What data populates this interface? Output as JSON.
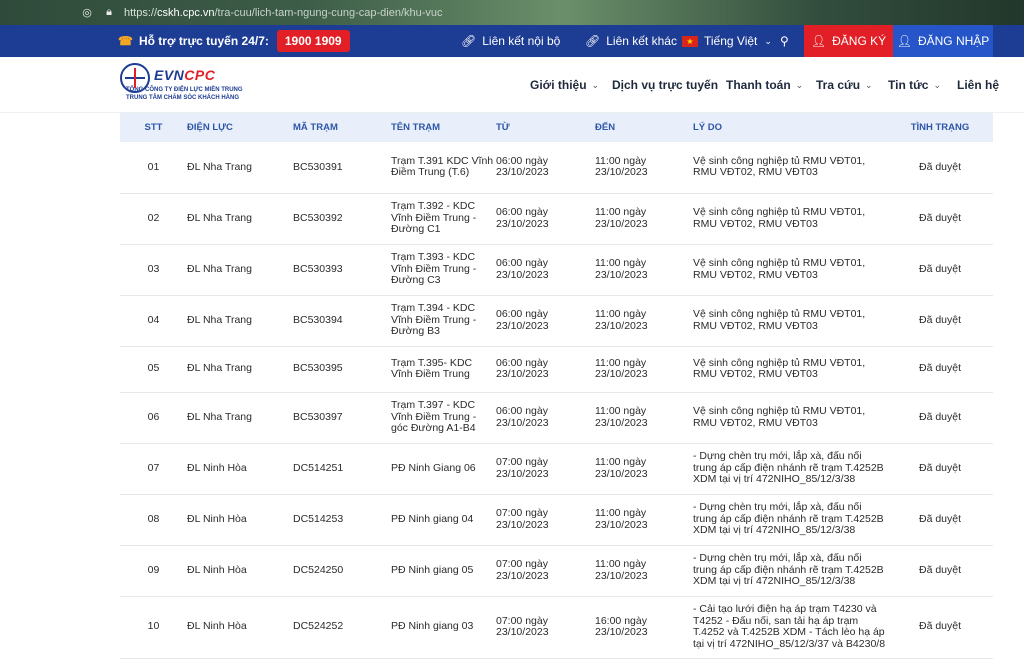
{
  "browser": {
    "url_prefix": "https://",
    "url_host": "cskh.cpc.vn",
    "url_path": "/tra-cuu/lich-tam-ngung-cung-cap-dien/khu-vuc"
  },
  "topbar": {
    "support_label": "Hỗ trợ trực tuyến 24/7:",
    "hotline": "1900 1909",
    "internal_link": "Liên kết nội bộ",
    "external_link": "Liên kết khác",
    "language": "Tiếng Việt",
    "register": "ĐĂNG KÝ",
    "login": "ĐĂNG NHẬP"
  },
  "logo": {
    "brand_evn": "EVN",
    "brand_cpc": "CPC",
    "line1": "TỔNG CÔNG TY ĐIỆN LỰC MIỀN TRUNG",
    "line2": "TRUNG TÂM CHĂM SÓC KHÁCH HÀNG"
  },
  "nav": {
    "about": "Giới thiệu",
    "services": "Dịch vụ trực tuyến",
    "payment": "Thanh toán",
    "lookup": "Tra cứu",
    "news": "Tin tức",
    "contact": "Liên hệ"
  },
  "table": {
    "headers": {
      "stt": "STT",
      "district": "ĐIỆN LỰC",
      "code": "MÃ TRẠM",
      "station": "TÊN TRẠM",
      "from": "TỪ",
      "to": "ĐẾN",
      "reason": "LÝ DO",
      "status": "TÌNH TRẠNG"
    },
    "rows": [
      {
        "stt": "01",
        "district": "ĐL Nha Trang",
        "code": "BC530391",
        "station": "Trạm T.391 KDC Vĩnh Điềm Trung (T.6)",
        "from": "06:00 ngày 23/10/2023",
        "to": "11:00 ngày 23/10/2023",
        "reason": "Vệ sinh công nghiệp tủ RMU VĐT01, RMU VĐT02, RMU VĐT03",
        "status": "Đã duyệt"
      },
      {
        "stt": "02",
        "district": "ĐL Nha Trang",
        "code": "BC530392",
        "station": "Trạm T.392 - KDC Vĩnh Điềm Trung - Đường C1",
        "from": "06:00 ngày 23/10/2023",
        "to": "11:00 ngày 23/10/2023",
        "reason": "Vệ sinh công nghiệp tủ RMU VĐT01, RMU VĐT02, RMU VĐT03",
        "status": "Đã duyệt"
      },
      {
        "stt": "03",
        "district": "ĐL Nha Trang",
        "code": "BC530393",
        "station": "Trạm T.393 - KDC Vĩnh Điềm Trung - Đường C3",
        "from": "06:00 ngày 23/10/2023",
        "to": "11:00 ngày 23/10/2023",
        "reason": "Vệ sinh công nghiệp tủ RMU VĐT01, RMU VĐT02, RMU VĐT03",
        "status": "Đã duyệt"
      },
      {
        "stt": "04",
        "district": "ĐL Nha Trang",
        "code": "BC530394",
        "station": "Trạm T.394 - KDC Vĩnh Điềm Trung - Đường B3",
        "from": "06:00 ngày 23/10/2023",
        "to": "11:00 ngày 23/10/2023",
        "reason": "Vệ sinh công nghiệp tủ RMU VĐT01, RMU VĐT02, RMU VĐT03",
        "status": "Đã duyệt"
      },
      {
        "stt": "05",
        "district": "ĐL Nha Trang",
        "code": "BC530395",
        "station": "Trạm T.395- KDC Vĩnh Điềm Trung",
        "from": "06:00 ngày 23/10/2023",
        "to": "11:00 ngày 23/10/2023",
        "reason": "Vệ sinh công nghiệp tủ RMU VĐT01, RMU VĐT02, RMU VĐT03",
        "status": "Đã duyệt"
      },
      {
        "stt": "06",
        "district": "ĐL Nha Trang",
        "code": "BC530397",
        "station": "Trạm T.397 - KDC Vĩnh Điềm Trung - góc Đường A1-B4",
        "from": "06:00 ngày 23/10/2023",
        "to": "11:00 ngày 23/10/2023",
        "reason": "Vệ sinh công nghiệp tủ RMU VĐT01, RMU VĐT02, RMU VĐT03",
        "status": "Đã duyệt"
      },
      {
        "stt": "07",
        "district": "ĐL Ninh Hòa",
        "code": "DC514251",
        "station": "PĐ Ninh Giang 06",
        "from": "07:00 ngày 23/10/2023",
        "to": "11:00 ngày 23/10/2023",
        "reason": "- Dựng chèn trụ mới, lắp xà, đấu nối trung áp cấp điện nhánh rẽ trạm T.4252B XDM tại vị trí 472NIHO_85/12/3/38",
        "status": "Đã duyệt"
      },
      {
        "stt": "08",
        "district": "ĐL Ninh Hòa",
        "code": "DC514253",
        "station": "PĐ Ninh giang 04",
        "from": "07:00 ngày 23/10/2023",
        "to": "11:00 ngày 23/10/2023",
        "reason": "- Dựng chèn trụ mới, lắp xà, đấu nối trung áp cấp điện nhánh rẽ trạm T.4252B XDM tại vị trí 472NIHO_85/12/3/38",
        "status": "Đã duyệt"
      },
      {
        "stt": "09",
        "district": "ĐL Ninh Hòa",
        "code": "DC524250",
        "station": "PĐ Ninh giang 05",
        "from": "07:00 ngày 23/10/2023",
        "to": "11:00 ngày 23/10/2023",
        "reason": "- Dựng chèn trụ mới, lắp xà, đấu nối trung áp cấp điện nhánh rẽ trạm T.4252B XDM tại vị trí 472NIHO_85/12/3/38",
        "status": "Đã duyệt"
      },
      {
        "stt": "10",
        "district": "ĐL Ninh Hòa",
        "code": "DC524252",
        "station": "PĐ Ninh giang 03",
        "from": "07:00 ngày 23/10/2023",
        "to": "16:00 ngày 23/10/2023",
        "reason": "- Cải tạo lưới điện hạ áp trạm T4230 và T4252 - Đấu nối, san tải hạ áp trạm T.4252 và T.4252B XDM - Tách lèo hạ áp tại vị trí 472NIHO_85/12/3/37 và B4230/8",
        "status": "Đã duyệt"
      }
    ]
  }
}
